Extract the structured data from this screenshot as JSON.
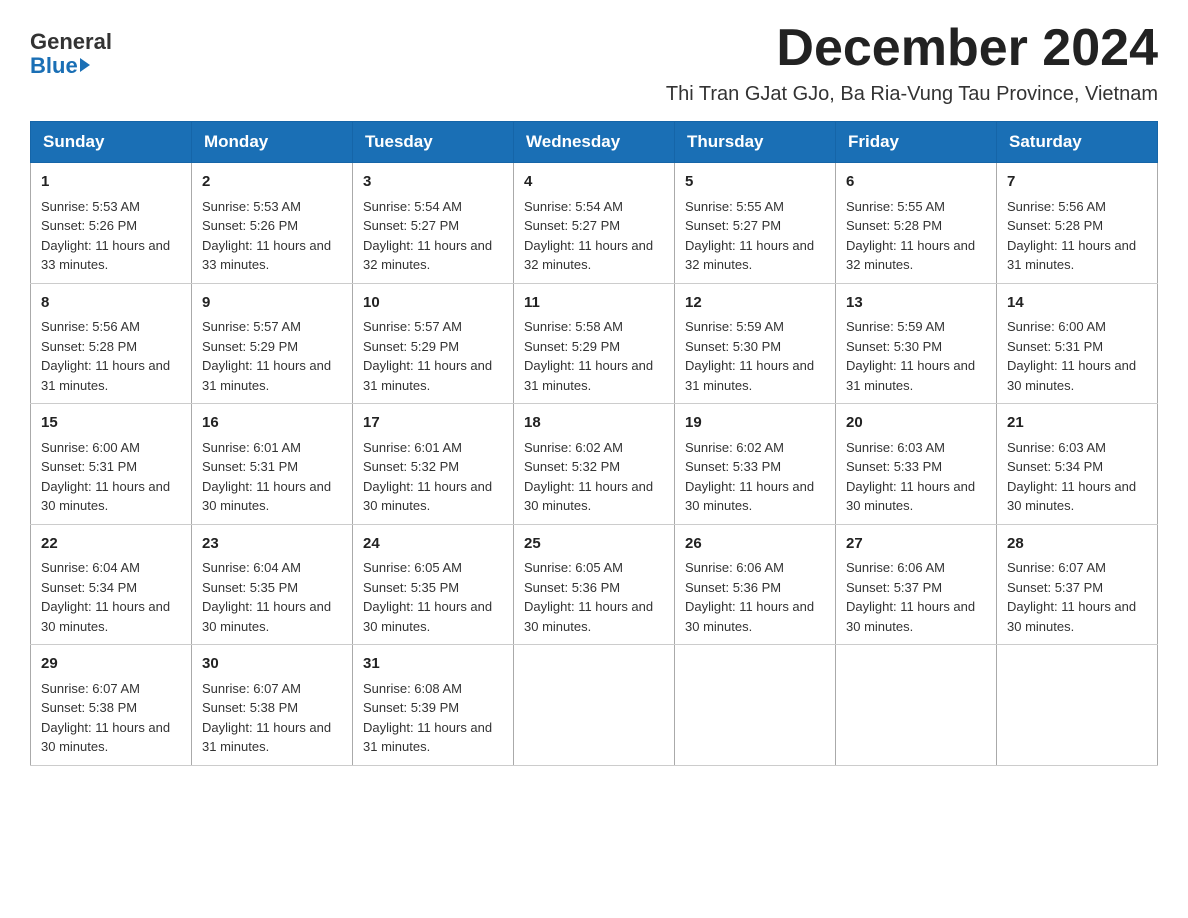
{
  "header": {
    "logo_general": "General",
    "logo_blue": "Blue",
    "title": "December 2024",
    "subtitle": "Thi Tran GJat GJo, Ba Ria-Vung Tau Province, Vietnam"
  },
  "days_of_week": [
    "Sunday",
    "Monday",
    "Tuesday",
    "Wednesday",
    "Thursday",
    "Friday",
    "Saturday"
  ],
  "weeks": [
    [
      {
        "day": 1,
        "sunrise": "5:53 AM",
        "sunset": "5:26 PM",
        "daylight": "11 hours and 33 minutes."
      },
      {
        "day": 2,
        "sunrise": "5:53 AM",
        "sunset": "5:26 PM",
        "daylight": "11 hours and 33 minutes."
      },
      {
        "day": 3,
        "sunrise": "5:54 AM",
        "sunset": "5:27 PM",
        "daylight": "11 hours and 32 minutes."
      },
      {
        "day": 4,
        "sunrise": "5:54 AM",
        "sunset": "5:27 PM",
        "daylight": "11 hours and 32 minutes."
      },
      {
        "day": 5,
        "sunrise": "5:55 AM",
        "sunset": "5:27 PM",
        "daylight": "11 hours and 32 minutes."
      },
      {
        "day": 6,
        "sunrise": "5:55 AM",
        "sunset": "5:28 PM",
        "daylight": "11 hours and 32 minutes."
      },
      {
        "day": 7,
        "sunrise": "5:56 AM",
        "sunset": "5:28 PM",
        "daylight": "11 hours and 31 minutes."
      }
    ],
    [
      {
        "day": 8,
        "sunrise": "5:56 AM",
        "sunset": "5:28 PM",
        "daylight": "11 hours and 31 minutes."
      },
      {
        "day": 9,
        "sunrise": "5:57 AM",
        "sunset": "5:29 PM",
        "daylight": "11 hours and 31 minutes."
      },
      {
        "day": 10,
        "sunrise": "5:57 AM",
        "sunset": "5:29 PM",
        "daylight": "11 hours and 31 minutes."
      },
      {
        "day": 11,
        "sunrise": "5:58 AM",
        "sunset": "5:29 PM",
        "daylight": "11 hours and 31 minutes."
      },
      {
        "day": 12,
        "sunrise": "5:59 AM",
        "sunset": "5:30 PM",
        "daylight": "11 hours and 31 minutes."
      },
      {
        "day": 13,
        "sunrise": "5:59 AM",
        "sunset": "5:30 PM",
        "daylight": "11 hours and 31 minutes."
      },
      {
        "day": 14,
        "sunrise": "6:00 AM",
        "sunset": "5:31 PM",
        "daylight": "11 hours and 30 minutes."
      }
    ],
    [
      {
        "day": 15,
        "sunrise": "6:00 AM",
        "sunset": "5:31 PM",
        "daylight": "11 hours and 30 minutes."
      },
      {
        "day": 16,
        "sunrise": "6:01 AM",
        "sunset": "5:31 PM",
        "daylight": "11 hours and 30 minutes."
      },
      {
        "day": 17,
        "sunrise": "6:01 AM",
        "sunset": "5:32 PM",
        "daylight": "11 hours and 30 minutes."
      },
      {
        "day": 18,
        "sunrise": "6:02 AM",
        "sunset": "5:32 PM",
        "daylight": "11 hours and 30 minutes."
      },
      {
        "day": 19,
        "sunrise": "6:02 AM",
        "sunset": "5:33 PM",
        "daylight": "11 hours and 30 minutes."
      },
      {
        "day": 20,
        "sunrise": "6:03 AM",
        "sunset": "5:33 PM",
        "daylight": "11 hours and 30 minutes."
      },
      {
        "day": 21,
        "sunrise": "6:03 AM",
        "sunset": "5:34 PM",
        "daylight": "11 hours and 30 minutes."
      }
    ],
    [
      {
        "day": 22,
        "sunrise": "6:04 AM",
        "sunset": "5:34 PM",
        "daylight": "11 hours and 30 minutes."
      },
      {
        "day": 23,
        "sunrise": "6:04 AM",
        "sunset": "5:35 PM",
        "daylight": "11 hours and 30 minutes."
      },
      {
        "day": 24,
        "sunrise": "6:05 AM",
        "sunset": "5:35 PM",
        "daylight": "11 hours and 30 minutes."
      },
      {
        "day": 25,
        "sunrise": "6:05 AM",
        "sunset": "5:36 PM",
        "daylight": "11 hours and 30 minutes."
      },
      {
        "day": 26,
        "sunrise": "6:06 AM",
        "sunset": "5:36 PM",
        "daylight": "11 hours and 30 minutes."
      },
      {
        "day": 27,
        "sunrise": "6:06 AM",
        "sunset": "5:37 PM",
        "daylight": "11 hours and 30 minutes."
      },
      {
        "day": 28,
        "sunrise": "6:07 AM",
        "sunset": "5:37 PM",
        "daylight": "11 hours and 30 minutes."
      }
    ],
    [
      {
        "day": 29,
        "sunrise": "6:07 AM",
        "sunset": "5:38 PM",
        "daylight": "11 hours and 30 minutes."
      },
      {
        "day": 30,
        "sunrise": "6:07 AM",
        "sunset": "5:38 PM",
        "daylight": "11 hours and 31 minutes."
      },
      {
        "day": 31,
        "sunrise": "6:08 AM",
        "sunset": "5:39 PM",
        "daylight": "11 hours and 31 minutes."
      },
      null,
      null,
      null,
      null
    ]
  ]
}
